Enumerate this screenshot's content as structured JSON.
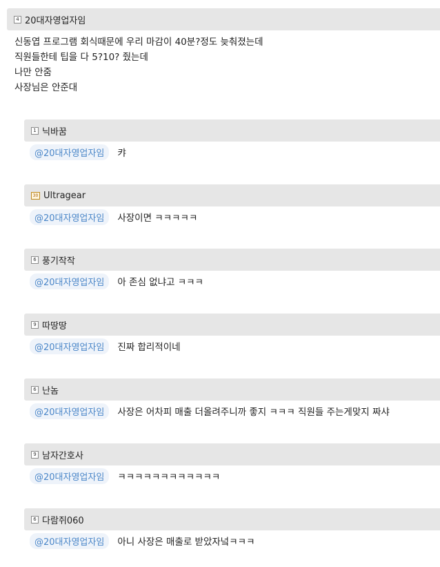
{
  "post": {
    "author": "20대자영업자임",
    "level": "4",
    "lines": [
      "신동엽 프로그램 회식때문에 우리 마감이 40분?정도 늦춰졌는데",
      "직원들한테 팁을 다 5?10? 줬는데",
      "나만 안줌",
      "사장님은 안준대"
    ]
  },
  "comments": [
    {
      "author": "닉바꿈",
      "level": "1",
      "mention": "@20대자영업자임",
      "text": "캬"
    },
    {
      "author": "Ultragear",
      "level": "30",
      "mention": "@20대자영업자임",
      "text": "사장이면 ㅋㅋㅋㅋㅋ"
    },
    {
      "author": "풍기작작",
      "level": "6",
      "mention": "@20대자영업자임",
      "text": "아 존심 없냐고 ㅋㅋㅋ"
    },
    {
      "author": "따땅땅",
      "level": "9",
      "mention": "@20대자영업자임",
      "text": "진짜 합리적이네"
    },
    {
      "author": "난놈",
      "level": "6",
      "mention": "@20대자영업자임",
      "text": "사장은 어차피 매출 더올려주니까 좋지 ㅋㅋㅋ 직원들 주는게맞지 짜샤"
    },
    {
      "author": "남자간호사",
      "level": "9",
      "mention": "@20대자영업자임",
      "text": "ㅋㅋㅋㅋㅋㅋㅋㅋㅋㅋㅋㅋ"
    },
    {
      "author": "다람쥐060",
      "level": "6",
      "mention": "@20대자영업자임",
      "text": "아니 사장은 매출로 받았자넠ㅋㅋㅋ"
    }
  ]
}
